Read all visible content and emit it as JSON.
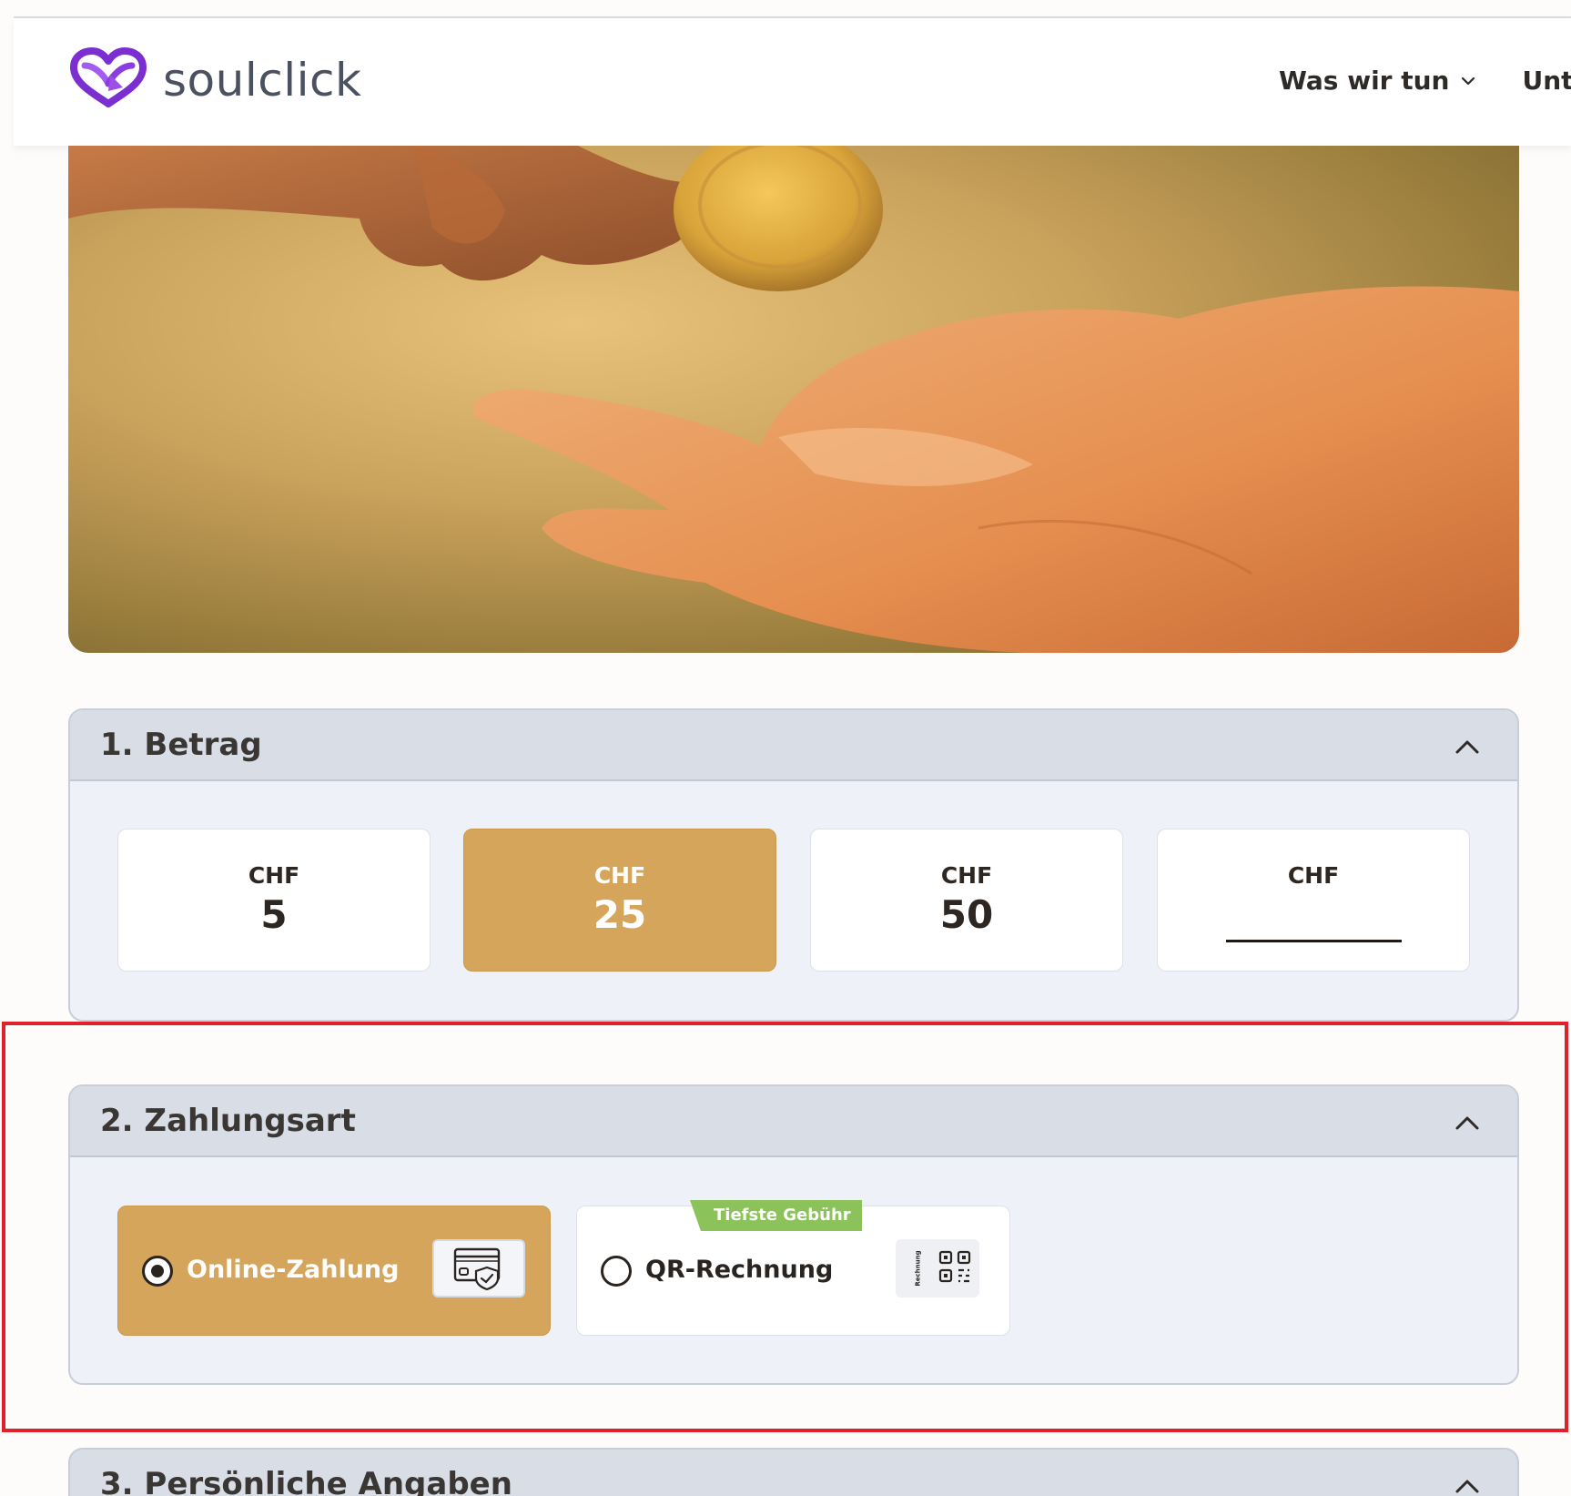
{
  "header": {
    "logo_text": "soulclick",
    "nav": [
      {
        "label": "Was wir tun",
        "has_dropdown": true
      },
      {
        "label": "Unte",
        "has_dropdown": false
      }
    ]
  },
  "hero": {
    "alt": "hand giving coin"
  },
  "sections": {
    "amount": {
      "title": "1. Betrag",
      "options": [
        {
          "currency": "CHF",
          "value": "5",
          "selected": false
        },
        {
          "currency": "CHF",
          "value": "25",
          "selected": true
        },
        {
          "currency": "CHF",
          "value": "50",
          "selected": false
        },
        {
          "currency": "CHF",
          "value": "",
          "selected": false,
          "custom": true
        }
      ]
    },
    "payment": {
      "title": "2. Zahlungsart",
      "options": [
        {
          "label": "Online-Zahlung",
          "selected": true,
          "icon": "credit-card-shield-icon"
        },
        {
          "label": "QR-Rechnung",
          "selected": false,
          "badge": "Tiefste Gebühr",
          "icon": "qr-invoice-icon",
          "icon_caption": "Rechnung"
        }
      ]
    },
    "personal": {
      "title": "3. Persönliche Angaben"
    }
  },
  "colors": {
    "accent": "#d4a55a",
    "panel_bg": "#eef1f8",
    "panel_head": "#d8dde6",
    "badge_green": "#8cc25a",
    "highlight_red": "#e0202a",
    "logo_purple": "#7b2fd0"
  }
}
